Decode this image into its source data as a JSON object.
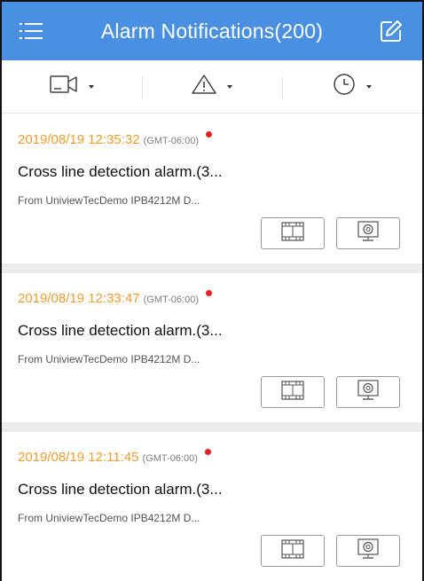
{
  "header": {
    "title": "Alarm Notifications(200)",
    "left_icon": "menu-icon",
    "right_icon": "edit-icon",
    "background_color": "#4a90e2"
  },
  "filters": [
    {
      "icon": "camera-icon"
    },
    {
      "icon": "alert-triangle-icon"
    },
    {
      "icon": "clock-icon"
    }
  ],
  "colors": {
    "timestamp": "#f39c2e",
    "unread_dot": "#e62020"
  },
  "alarms": [
    {
      "time": "2019/08/19 12:35:32",
      "timezone": "(GMT-06:00)",
      "title": "Cross line detection alarm.(3...",
      "source": "From UniviewTecDemo IPB4212M D...",
      "unread": true
    },
    {
      "time": "2019/08/19 12:33:47",
      "timezone": "(GMT-06:00)",
      "title": "Cross line detection alarm.(3...",
      "source": "From UniviewTecDemo IPB4212M D...",
      "unread": true
    },
    {
      "time": "2019/08/19 12:11:45",
      "timezone": "(GMT-06:00)",
      "title": "Cross line detection alarm.(3...",
      "source": "From UniviewTecDemo IPB4212M D...",
      "unread": true
    }
  ],
  "actions": {
    "playback_icon": "film-icon",
    "live_icon": "monitor-icon"
  }
}
